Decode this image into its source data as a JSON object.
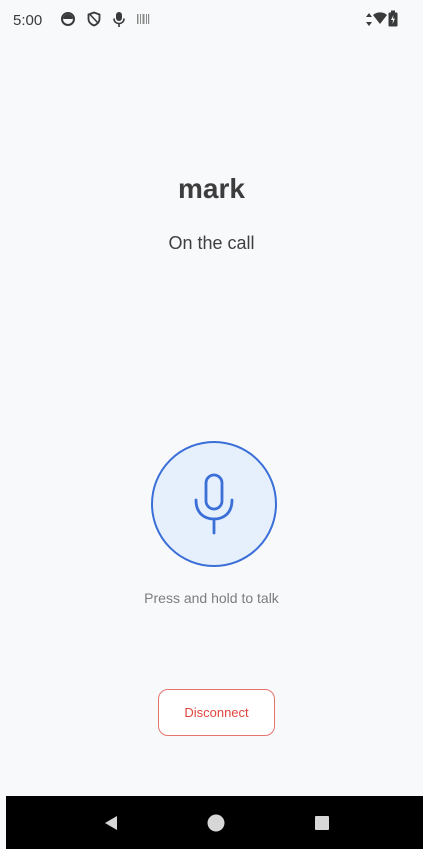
{
  "status_bar": {
    "time": "5:00",
    "icons_left": [
      "data-saver-icon",
      "shield-icon",
      "mic-status-icon",
      "barcode-icon"
    ],
    "icons_right": [
      "signal-arrows-icon",
      "wifi-icon",
      "battery-icon"
    ]
  },
  "call": {
    "name": "mark",
    "status": "On the call"
  },
  "talk": {
    "hint": "Press and hold to talk"
  },
  "actions": {
    "disconnect_label": "Disconnect"
  },
  "colors": {
    "accent": "#3b6fd8",
    "mic_background": "#e6effc",
    "danger": "#e0463e",
    "danger_border": "#e3756f",
    "background": "#f8f9fb"
  },
  "nav": {
    "buttons": [
      "back-icon",
      "home-icon",
      "recents-icon"
    ]
  }
}
